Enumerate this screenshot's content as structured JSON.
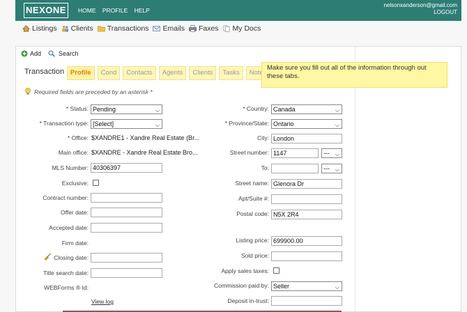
{
  "topbar": {
    "logo": "NEXONE",
    "nav": [
      "HOME",
      "PROFILE",
      "HELP"
    ],
    "user_email": "nelsonxanderson@gmail.com",
    "logout": "LOGOUT"
  },
  "mainnav": [
    {
      "label": "Listings",
      "icon": "house-icon"
    },
    {
      "label": "Clients",
      "icon": "people-icon"
    },
    {
      "label": "Transactions",
      "icon": "folder-icon"
    },
    {
      "label": "Emails",
      "icon": "envelope-icon"
    },
    {
      "label": "Faxes",
      "icon": "fax-icon"
    },
    {
      "label": "My Docs",
      "icon": "documents-icon"
    }
  ],
  "actions": {
    "add": "Add",
    "search": "Search"
  },
  "page_title": "Transaction",
  "tabs": [
    "Profile",
    "Cond",
    "Contacts",
    "Agents",
    "Clients",
    "Tasks",
    "Note"
  ],
  "callout": "Make sure you fill out all of the information through out these tabs.",
  "required_note": "Required fields are preceded by an asterisk *",
  "left_fields": {
    "status": {
      "label": "* Status:",
      "value": "Pending"
    },
    "transaction_type": {
      "label": "* Transaction type:",
      "value": "[Select]"
    },
    "office": {
      "label": "* Office:",
      "value": "$XANDRE1 - Xandre Real Estate (Br..."
    },
    "main_office": {
      "label": "Main office:",
      "value": "$XANDRE - Xandre Real Estate Bro..."
    },
    "mls_number": {
      "label": "MLS Number:",
      "value": "40306397"
    },
    "exclusive": {
      "label": "Exclusive:"
    },
    "contract_number": {
      "label": "Contract number:",
      "value": ""
    },
    "offer_date": {
      "label": "Offer date:",
      "value": ""
    },
    "accepted_date": {
      "label": "Accepted date:",
      "value": ""
    },
    "firm_date": {
      "label": "Firm date:"
    },
    "closing_date": {
      "label": "Closing date:",
      "value": ""
    },
    "title_search_date": {
      "label": "Title search date:",
      "value": ""
    },
    "webforms_id": {
      "label": "WEBForms ® Id:"
    },
    "view_log": "View log"
  },
  "right_fields": {
    "country": {
      "label": "* Country:",
      "value": "Canada"
    },
    "province": {
      "label": "* Province/State:",
      "value": "Ontario"
    },
    "city": {
      "label": "City:",
      "value": "London"
    },
    "street_number": {
      "label": "Street number:",
      "value": "1147",
      "suffix": "---"
    },
    "to": {
      "label": "To:",
      "value": "",
      "suffix": "---"
    },
    "street_name": {
      "label": "Street name:",
      "value": "Glenora Dr"
    },
    "apt_suite": {
      "label": "Apt/Suite #:",
      "value": ""
    },
    "postal_code": {
      "label": "Postal code:",
      "value": "N5X 2R4"
    },
    "listing_price": {
      "label": "Listing price:",
      "value": "699900.00"
    },
    "sold_price": {
      "label": "Sold price:",
      "value": ""
    },
    "apply_sales_taxes": {
      "label": "Apply sales taxes:"
    },
    "commission_paid_by": {
      "label": "Commission paid by:",
      "value": "Seller"
    },
    "deposit_in_trust": {
      "label": "Deposit in-trust:",
      "value": ""
    }
  },
  "colors": {
    "brand": "#2d7d74",
    "tab_active": "#e87d00",
    "callout": "#fff7a3"
  }
}
